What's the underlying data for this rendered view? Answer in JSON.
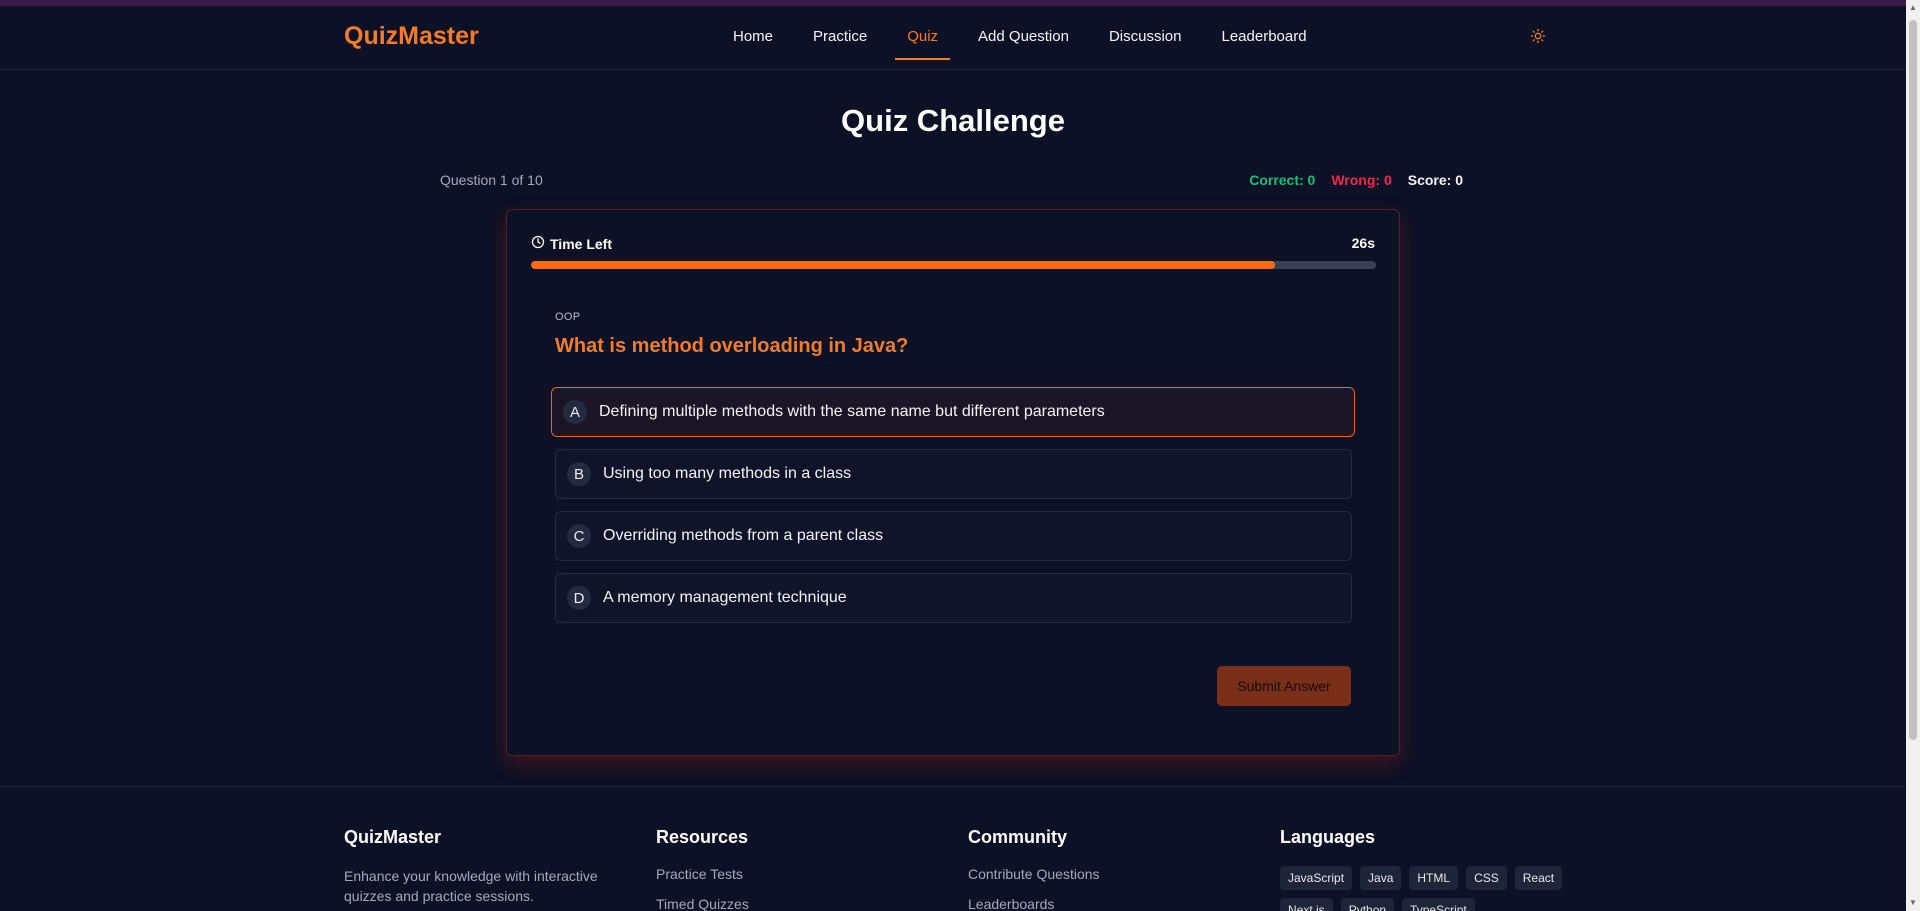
{
  "header": {
    "brand": "QuizMaster",
    "nav": [
      "Home",
      "Practice",
      "Quiz",
      "Add Question",
      "Discussion",
      "Leaderboard"
    ],
    "active_nav": "Quiz",
    "theme_icon": "sun-icon"
  },
  "quiz": {
    "title": "Quiz Challenge",
    "question_counter": "Question 1 of 10",
    "correct": "Correct: 0",
    "wrong": "Wrong: 0",
    "score": "Score: 0",
    "timer_label": "Time Left",
    "timer_value": "26s",
    "timer_progress_fraction": 0.88,
    "category": "OOP",
    "question": "What is method overloading in Java?",
    "options": [
      {
        "letter": "A",
        "text": "Defining multiple methods with the same name but different parameters"
      },
      {
        "letter": "B",
        "text": "Using too many methods in a class"
      },
      {
        "letter": "C",
        "text": "Overriding methods from a parent class"
      },
      {
        "letter": "D",
        "text": "A memory management technique"
      }
    ],
    "selected_option": "A",
    "submit_label": "Submit Answer"
  },
  "footer": {
    "brand": {
      "title": "QuizMaster",
      "desc": "Enhance your knowledge with interactive quizzes and practice sessions."
    },
    "resources": {
      "title": "Resources",
      "links": [
        "Practice Tests",
        "Timed Quizzes"
      ]
    },
    "community": {
      "title": "Community",
      "links": [
        "Contribute Questions",
        "Leaderboards"
      ]
    },
    "languages": {
      "title": "Languages",
      "tags": [
        "JavaScript",
        "Java",
        "HTML",
        "CSS",
        "React",
        "Next.js",
        "Python",
        "TypeScript"
      ]
    }
  },
  "colors": {
    "accent": "#f47b2a",
    "progress": "#ff6a13",
    "correct": "#19c07a",
    "wrong": "#ef2a50",
    "background": "#0d1126"
  }
}
